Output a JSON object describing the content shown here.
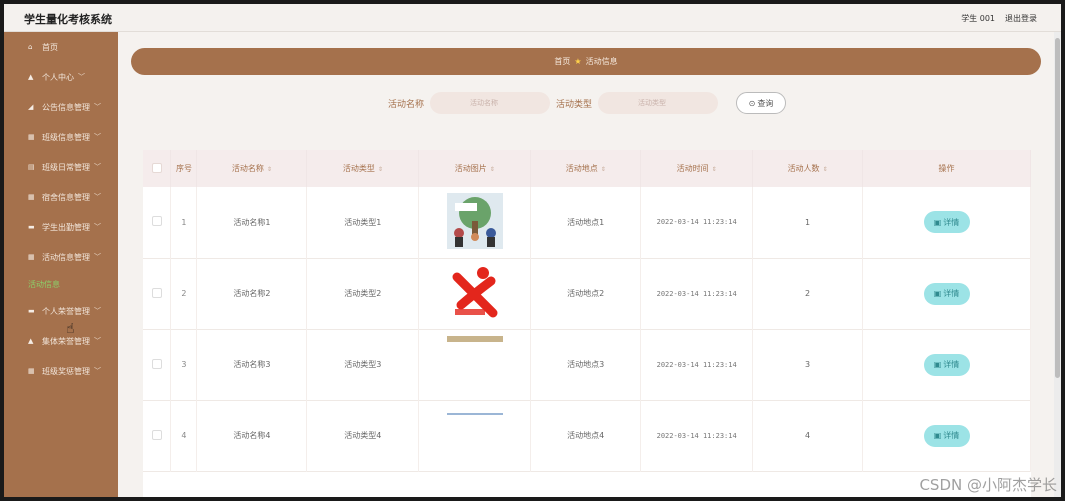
{
  "header": {
    "title": "学生量化考核系统",
    "user": "学生 001",
    "logout": "退出登录"
  },
  "sidebar": {
    "items": [
      {
        "label": "首页",
        "icon": "home-icon",
        "glyph": "⌂",
        "chevron": ""
      },
      {
        "label": "个人中心",
        "icon": "user-icon",
        "glyph": "▲",
        "chevron": "﹀"
      },
      {
        "label": "公告信息管理",
        "icon": "megaphone-icon",
        "glyph": "◢",
        "chevron": "﹀"
      },
      {
        "label": "班级信息管理",
        "icon": "grid-icon",
        "glyph": "▦",
        "chevron": "﹀"
      },
      {
        "label": "班级日常管理",
        "icon": "grid-icon",
        "glyph": "▤",
        "chevron": "﹀"
      },
      {
        "label": "宿舍信息管理",
        "icon": "grid-icon",
        "glyph": "▦",
        "chevron": "﹀"
      },
      {
        "label": "学生出勤管理",
        "icon": "list-icon",
        "glyph": "▬",
        "chevron": "﹀"
      },
      {
        "label": "活动信息管理",
        "icon": "grid-icon",
        "glyph": "▦",
        "chevron": "﹀"
      },
      {
        "label": "活动信息",
        "icon": "",
        "glyph": "",
        "chevron": "",
        "active": true
      },
      {
        "label": "个人荣誉管理",
        "icon": "list-icon",
        "glyph": "▬",
        "chevron": "﹀"
      },
      {
        "label": "集体荣誉管理",
        "icon": "user-icon",
        "glyph": "▲",
        "chevron": "﹀"
      },
      {
        "label": "班级奖惩管理",
        "icon": "grid-icon",
        "glyph": "▦",
        "chevron": "﹀"
      }
    ]
  },
  "breadcrumb": {
    "home": "首页",
    "current": "活动信息"
  },
  "search": {
    "name_label": "活动名称",
    "name_placeholder": "活动名称",
    "type_label": "活动类型",
    "type_placeholder": "活动类型",
    "button": "查询"
  },
  "table": {
    "headers": {
      "index": "序号",
      "name": "活动名称",
      "type": "活动类型",
      "image": "活动图片",
      "place": "活动地点",
      "time": "活动时间",
      "count": "活动人数",
      "ops": "操作"
    },
    "detail_label": "详情",
    "rows": [
      {
        "index": "1",
        "name": "活动名称1",
        "type": "活动类型1",
        "place": "活动地点1",
        "time": "2022-03-14 11:23:14",
        "count": "1"
      },
      {
        "index": "2",
        "name": "活动名称2",
        "type": "活动类型2",
        "place": "活动地点2",
        "time": "2022-03-14 11:23:14",
        "count": "2"
      },
      {
        "index": "3",
        "name": "活动名称3",
        "type": "活动类型3",
        "place": "活动地点3",
        "time": "2022-03-14 11:23:14",
        "count": "3"
      },
      {
        "index": "4",
        "name": "活动名称4",
        "type": "活动类型4",
        "place": "活动地点4",
        "time": "2022-03-14 11:23:14",
        "count": "4"
      }
    ]
  },
  "watermark": "CSDN @小阿杰学长",
  "colors": {
    "brand": "#a5714c",
    "active": "#8bd06a",
    "detail_button": "#9ce3e6"
  }
}
